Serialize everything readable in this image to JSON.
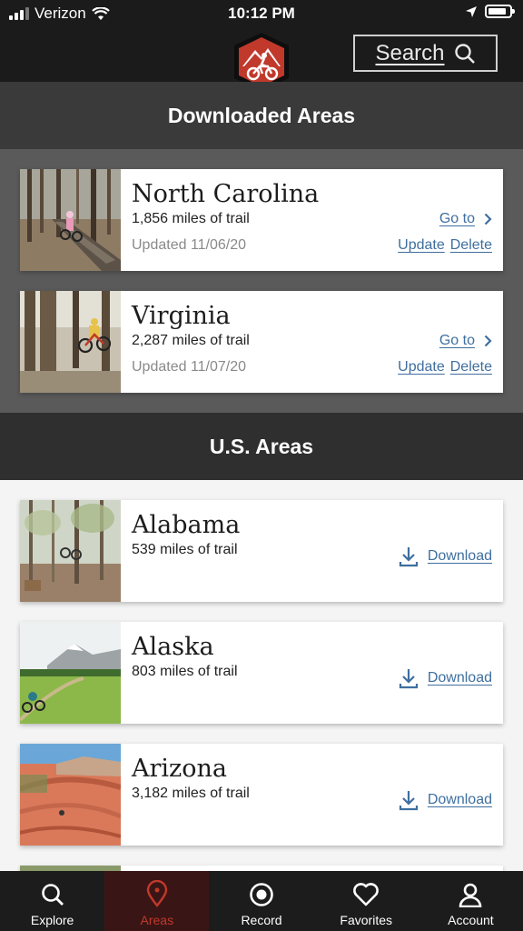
{
  "status": {
    "carrier": "Verizon",
    "time": "10:12 PM",
    "battery_level": 0.85
  },
  "header": {
    "search_label": "Search",
    "logo_icon": "mountain-biker-icon"
  },
  "downloaded": {
    "title": "Downloaded Areas",
    "items": [
      {
        "name": "North Carolina",
        "miles": "1,856 miles of trail",
        "updated": "Updated 11/06/20",
        "goto": "Go to",
        "update": "Update",
        "delete": "Delete"
      },
      {
        "name": "Virginia",
        "miles": "2,287 miles of trail",
        "updated": "Updated 11/07/20",
        "goto": "Go to",
        "update": "Update",
        "delete": "Delete"
      }
    ]
  },
  "us_areas": {
    "title": "U.S. Areas",
    "items": [
      {
        "name": "Alabama",
        "miles": "539 miles of trail",
        "download": "Download"
      },
      {
        "name": "Alaska",
        "miles": "803 miles of trail",
        "download": "Download"
      },
      {
        "name": "Arizona",
        "miles": "3,182 miles of trail",
        "download": "Download"
      }
    ]
  },
  "tabs": [
    {
      "label": "Explore",
      "icon": "search-icon"
    },
    {
      "label": "Areas",
      "icon": "map-pin-icon",
      "active": true
    },
    {
      "label": "Record",
      "icon": "record-icon"
    },
    {
      "label": "Favorites",
      "icon": "heart-icon"
    },
    {
      "label": "Account",
      "icon": "user-icon"
    }
  ],
  "colors": {
    "accent": "#c0392b",
    "link": "#3f6f9f"
  }
}
